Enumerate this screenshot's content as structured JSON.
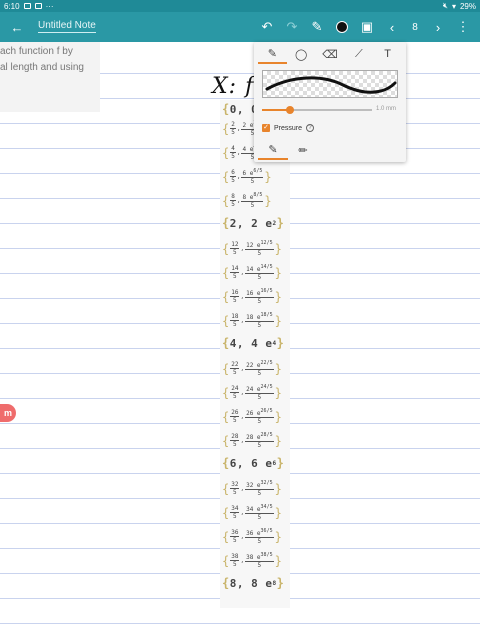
{
  "status": {
    "time": "6:10",
    "battery": "29%"
  },
  "toolbar": {
    "title": "Untitled Note",
    "page": "8"
  },
  "textcard": {
    "line1": "ach function f by",
    "line2": "al length and using"
  },
  "handwriting": "X: f",
  "pen_panel": {
    "size_label": "1.0 mm",
    "pressure_label": "Pressure",
    "pressure_checked": true,
    "stroke_size_fraction": 0.25
  },
  "results": [
    {
      "type": "simple",
      "text": "0, 0"
    },
    {
      "type": "frac",
      "a": "2",
      "b": "2 e",
      "exp": "2/5"
    },
    {
      "type": "frac",
      "a": "4",
      "b": "4 e",
      "exp": "4/5"
    },
    {
      "type": "frac",
      "a": "6",
      "b": "6 e",
      "exp": "6/5"
    },
    {
      "type": "frac",
      "a": "8",
      "b": "8 e",
      "exp": "8/5"
    },
    {
      "type": "simple",
      "text": "2, 2 e",
      "exp": "2"
    },
    {
      "type": "frac",
      "a": "12",
      "b": "12 e",
      "exp": "12/5"
    },
    {
      "type": "frac",
      "a": "14",
      "b": "14 e",
      "exp": "14/5"
    },
    {
      "type": "frac",
      "a": "16",
      "b": "16 e",
      "exp": "16/5"
    },
    {
      "type": "frac",
      "a": "18",
      "b": "18 e",
      "exp": "18/5"
    },
    {
      "type": "simple",
      "text": "4, 4 e",
      "exp": "4"
    },
    {
      "type": "frac",
      "a": "22",
      "b": "22 e",
      "exp": "22/5"
    },
    {
      "type": "frac",
      "a": "24",
      "b": "24 e",
      "exp": "24/5"
    },
    {
      "type": "frac",
      "a": "26",
      "b": "26 e",
      "exp": "26/5"
    },
    {
      "type": "frac",
      "a": "28",
      "b": "28 e",
      "exp": "28/5"
    },
    {
      "type": "simple",
      "text": "6, 6 e",
      "exp": "6"
    },
    {
      "type": "frac",
      "a": "32",
      "b": "32 e",
      "exp": "32/5"
    },
    {
      "type": "frac",
      "a": "34",
      "b": "34 e",
      "exp": "34/5"
    },
    {
      "type": "frac",
      "a": "36",
      "b": "36 e",
      "exp": "36/5"
    },
    {
      "type": "frac",
      "a": "38",
      "b": "38 e",
      "exp": "38/5"
    },
    {
      "type": "simple",
      "text": "8, 8 e",
      "exp": "8"
    }
  ],
  "frac_denominator": "5",
  "side_badge": "m",
  "colors": {
    "accent": "#2a98a5",
    "orange": "#e8842c",
    "pen": "#111111"
  }
}
